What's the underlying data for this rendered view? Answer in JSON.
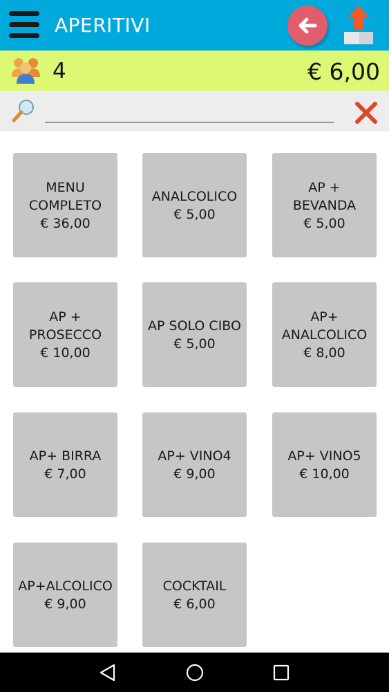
{
  "header": {
    "title": "APERITIVI",
    "menu_icon": "hamburger-menu-icon",
    "back_icon": "arrow-left-icon",
    "upload_icon": "upload-icon",
    "color": "#00a9dc"
  },
  "summary": {
    "guests_icon": "people-icon",
    "guest_count": "4",
    "total": "€ 6,00",
    "color": "#ddf872"
  },
  "search": {
    "value": "",
    "placeholder": "",
    "search_icon": "magnifier-icon",
    "clear_icon": "close-icon"
  },
  "products": [
    {
      "name": "MENU\nCOMPLETO",
      "price": "€ 36,00"
    },
    {
      "name": "ANALCOLICO",
      "price": "€ 5,00"
    },
    {
      "name": "AP +\nBEVANDA",
      "price": "€ 5,00"
    },
    {
      "name": "AP +\nPROSECCO",
      "price": "€ 10,00"
    },
    {
      "name": "AP SOLO CIBO",
      "price": "€ 5,00"
    },
    {
      "name": "AP+\nANALCOLICO",
      "price": "€ 8,00"
    },
    {
      "name": "AP+ BIRRA",
      "price": "€ 7,00"
    },
    {
      "name": "AP+ VINO4",
      "price": "€ 9,00"
    },
    {
      "name": "AP+ VINO5",
      "price": "€ 10,00"
    },
    {
      "name": "AP+ALCOLICO",
      "price": "€ 9,00"
    },
    {
      "name": "COCKTAIL",
      "price": "€ 6,00"
    }
  ],
  "system_nav": {
    "back_icon": "triangle-back-icon",
    "home_icon": "circle-home-icon",
    "recents_icon": "square-recents-icon"
  }
}
